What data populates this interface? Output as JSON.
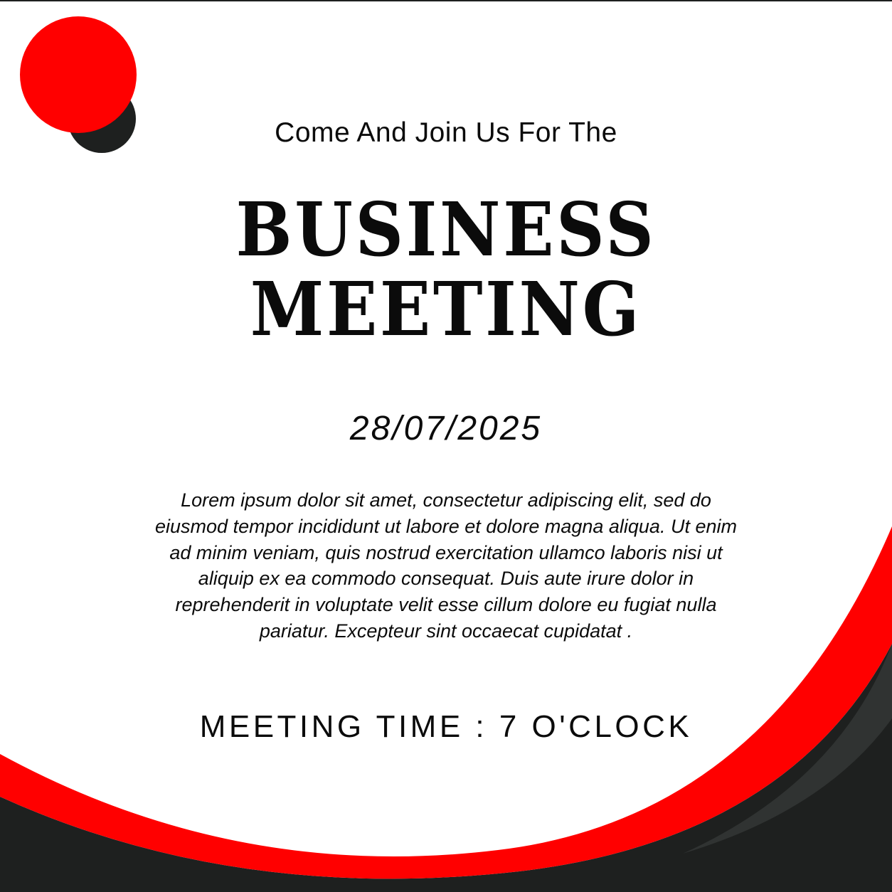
{
  "flyer": {
    "subheading": "Come And Join Us For The",
    "title_line_1": "BUSINESS",
    "title_line_2": "MEETING",
    "date": "28/07/2025",
    "description": "Lorem ipsum dolor sit amet, consectetur adipiscing elit, sed do eiusmod tempor incididunt ut labore et dolore magna aliqua. Ut enim ad minim veniam, quis nostrud exercitation ullamco laboris nisi ut aliquip ex ea commodo consequat. Duis aute irure dolor in reprehenderit in voluptate velit esse cillum dolore eu fugiat nulla pariatur. Excepteur sint occaecat cupidatat .",
    "meeting_time": "MEETING TIME : 7 O'CLOCK"
  },
  "colors": {
    "accent_red": "#ff0000",
    "dark_charcoal": "#1e201f",
    "charcoal_mid": "#303332",
    "background": "#ffffff",
    "text": "#0b0b0b"
  },
  "decorations": {
    "top_left": [
      "red-circle",
      "charcoal-circle"
    ],
    "bottom": [
      "red-swoosh",
      "charcoal-swoosh"
    ]
  }
}
